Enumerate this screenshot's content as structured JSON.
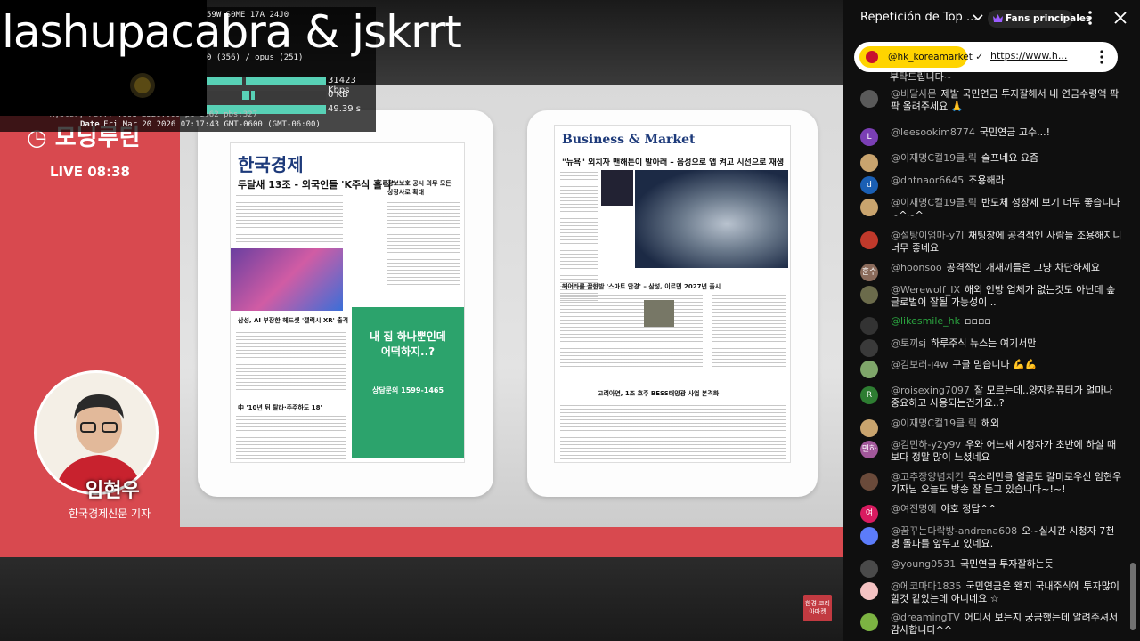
{
  "overlay": {
    "title": "lashupacabra & jskrrt",
    "stats": {
      "line1": "59W S0ME  17A 24J0",
      "line2": "0 (356) / opus (251)",
      "line3": "Mystery Fe...    .661-2326.000 pl_i:62 pbs:327",
      "date_label": "Date",
      "date_value": "Fri Mar 20 2026 07:17:43 GMT-0600 (GMT-06:00)",
      "rate1": "31423 Kbps",
      "rate2": "0 KB",
      "rate3": "49.39 s"
    }
  },
  "broadcast": {
    "live_label": "LIVE 08:38",
    "host_name": "임현우",
    "host_role": "한국경제신문 기자",
    "corner_logo": "한경 코리아마켓"
  },
  "newspaper_left": {
    "masthead": "한국경제",
    "headline": "두달새 13조 - 외국인들 'K주식 홀릭'",
    "subhead": "정보보호 공시 의무 모든 상장사로 확대",
    "caption": "삼성, AI 부장한 헤드셋 '갤럭시 XR' 출격",
    "bottom_head": "中 '10년 뒤 탈라·주주하도 18'",
    "ad_line1": "내 집 하나뿐인데",
    "ad_line2": "어떡하지..?",
    "ad_phone": "상담문의 1599-1465"
  },
  "newspaper_right": {
    "masthead": "Business & Market",
    "headline": "\"뉴욕\" 외치자 맨해튼이 발아래 – 음성으로 앱 켜고 시선으로 재생",
    "subhead": "헤어라를 끌한받 '스마트 안경' – 삼성, 이르면 2027년 출시",
    "bottom_head": "고려아연, 1조 호주 BESS태양광 사업 본격화"
  },
  "chat": {
    "title": "Repetición de Top ...",
    "fans_label": "Fans principales",
    "pinned": {
      "channel": "@hk_koreamarket",
      "link": "https://www.h...",
      "tail": "부탁드립니다~"
    },
    "messages": [
      {
        "author": "@비달사몬",
        "text": "제발 국민연금 투자잘해서 내 연금수령액 팍팍 올려주세요 🙏",
        "avatar_color": "#5a5a5a",
        "avatar_text": ""
      },
      {
        "author": "@leesookim8774",
        "text": "국민연금 고수...!",
        "avatar_color": "#7b3fb5",
        "avatar_text": "L"
      },
      {
        "author": "@이재명C컬19클.릭",
        "text": "슬프네요 요즘",
        "avatar_color": "#c9a46e",
        "avatar_text": ""
      },
      {
        "author": "@dhtnaor6645",
        "text": "조용해라",
        "avatar_color": "#1a5fb4",
        "avatar_text": "d"
      },
      {
        "author": "@이재명C컬19클.릭",
        "text": "반도체 성장세 보기 너무 좋습니다~^~^",
        "avatar_color": "#c9a46e",
        "avatar_text": ""
      },
      {
        "author": "@설탕이엄마-y7l",
        "text": "채팅창에 공격적인 사람들 조용해지니 너무 좋네요",
        "avatar_color": "#c0392b",
        "avatar_text": ""
      },
      {
        "author": "@hoonsoo",
        "text": "공격적인 개새끼들은 그냥 차단하세요",
        "avatar_color": "#8b6b5b",
        "avatar_text": "훈수"
      },
      {
        "author": "@Werewolf_IX",
        "text": "해외 인방 업체가 없는것도 아닌데 숲 글로벌이 잘될 가능성이 ..",
        "avatar_color": "#6b6b4b",
        "avatar_text": ""
      },
      {
        "author": "@likesmile_hk",
        "text": "▫▫▫▫",
        "avatar_color": "#333",
        "avatar_text": "",
        "green": true
      },
      {
        "author": "@토끼sj",
        "text": "하루주식 뉴스는 여기서만",
        "avatar_color": "#3a3a3a",
        "avatar_text": ""
      },
      {
        "author": "@김보러-j4w",
        "text": "구글 믿습니다 💪💪",
        "avatar_color": "#7fa66a",
        "avatar_text": ""
      },
      {
        "author": "@roisexing7097",
        "text": "잘 모르는데..양자컴퓨터가 얼마나 중요하고 사용되는건가요..?",
        "avatar_color": "#2e7d32",
        "avatar_text": "R"
      },
      {
        "author": "@이재명C컬19클.릭",
        "text": "해외",
        "avatar_color": "#c9a46e",
        "avatar_text": ""
      },
      {
        "author": "@김민하-y2y9v",
        "text": "우와 어느새 시청자가 초반에 하실 때보다 정말 많이 느셨네요",
        "avatar_color": "#a1579a",
        "avatar_text": "민하"
      },
      {
        "author": "@고추장양념치킨",
        "text": "목소리만큼 얼굴도 갈미로우신 임현우기자님 오늘도 방송 잘 듣고 있습니다~!~!",
        "avatar_color": "#6a4a3a",
        "avatar_text": ""
      },
      {
        "author": "@여전명에",
        "text": "야호 정답^^",
        "avatar_color": "#d81b60",
        "avatar_text": "여"
      },
      {
        "author": "@꿈꾸는다락방-andrena608",
        "text": "오~실시간 시청자 7천명 돌파를 앞두고 있네요.",
        "avatar_color": "#5c7cfa",
        "avatar_text": ""
      },
      {
        "author": "@young0531",
        "text": "국민연금 투자잘하는듯",
        "avatar_color": "#4a4a4a",
        "avatar_text": ""
      },
      {
        "author": "@에코마마1835",
        "text": "국민연금은 왠지 국내주식에 투자많이 할것 같았는데 아니네요 ☆",
        "avatar_color": "#f4c2c2",
        "avatar_text": ""
      },
      {
        "author": "@dreamingTV",
        "text": "어디서 보는지 궁금했는데 알려주셔서 감사합니다^^",
        "avatar_color": "#7cb342",
        "avatar_text": ""
      }
    ]
  }
}
